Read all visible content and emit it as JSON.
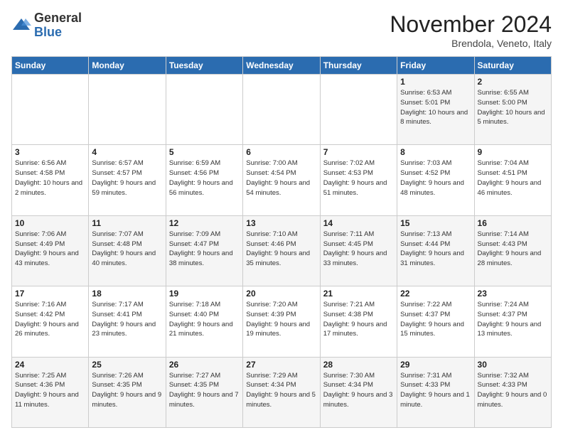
{
  "logo": {
    "general": "General",
    "blue": "Blue"
  },
  "title": "November 2024",
  "location": "Brendola, Veneto, Italy",
  "days_of_week": [
    "Sunday",
    "Monday",
    "Tuesday",
    "Wednesday",
    "Thursday",
    "Friday",
    "Saturday"
  ],
  "weeks": [
    [
      {
        "day": "",
        "info": ""
      },
      {
        "day": "",
        "info": ""
      },
      {
        "day": "",
        "info": ""
      },
      {
        "day": "",
        "info": ""
      },
      {
        "day": "",
        "info": ""
      },
      {
        "day": "1",
        "info": "Sunrise: 6:53 AM\nSunset: 5:01 PM\nDaylight: 10 hours and 8 minutes."
      },
      {
        "day": "2",
        "info": "Sunrise: 6:55 AM\nSunset: 5:00 PM\nDaylight: 10 hours and 5 minutes."
      }
    ],
    [
      {
        "day": "3",
        "info": "Sunrise: 6:56 AM\nSunset: 4:58 PM\nDaylight: 10 hours and 2 minutes."
      },
      {
        "day": "4",
        "info": "Sunrise: 6:57 AM\nSunset: 4:57 PM\nDaylight: 9 hours and 59 minutes."
      },
      {
        "day": "5",
        "info": "Sunrise: 6:59 AM\nSunset: 4:56 PM\nDaylight: 9 hours and 56 minutes."
      },
      {
        "day": "6",
        "info": "Sunrise: 7:00 AM\nSunset: 4:54 PM\nDaylight: 9 hours and 54 minutes."
      },
      {
        "day": "7",
        "info": "Sunrise: 7:02 AM\nSunset: 4:53 PM\nDaylight: 9 hours and 51 minutes."
      },
      {
        "day": "8",
        "info": "Sunrise: 7:03 AM\nSunset: 4:52 PM\nDaylight: 9 hours and 48 minutes."
      },
      {
        "day": "9",
        "info": "Sunrise: 7:04 AM\nSunset: 4:51 PM\nDaylight: 9 hours and 46 minutes."
      }
    ],
    [
      {
        "day": "10",
        "info": "Sunrise: 7:06 AM\nSunset: 4:49 PM\nDaylight: 9 hours and 43 minutes."
      },
      {
        "day": "11",
        "info": "Sunrise: 7:07 AM\nSunset: 4:48 PM\nDaylight: 9 hours and 40 minutes."
      },
      {
        "day": "12",
        "info": "Sunrise: 7:09 AM\nSunset: 4:47 PM\nDaylight: 9 hours and 38 minutes."
      },
      {
        "day": "13",
        "info": "Sunrise: 7:10 AM\nSunset: 4:46 PM\nDaylight: 9 hours and 35 minutes."
      },
      {
        "day": "14",
        "info": "Sunrise: 7:11 AM\nSunset: 4:45 PM\nDaylight: 9 hours and 33 minutes."
      },
      {
        "day": "15",
        "info": "Sunrise: 7:13 AM\nSunset: 4:44 PM\nDaylight: 9 hours and 31 minutes."
      },
      {
        "day": "16",
        "info": "Sunrise: 7:14 AM\nSunset: 4:43 PM\nDaylight: 9 hours and 28 minutes."
      }
    ],
    [
      {
        "day": "17",
        "info": "Sunrise: 7:16 AM\nSunset: 4:42 PM\nDaylight: 9 hours and 26 minutes."
      },
      {
        "day": "18",
        "info": "Sunrise: 7:17 AM\nSunset: 4:41 PM\nDaylight: 9 hours and 23 minutes."
      },
      {
        "day": "19",
        "info": "Sunrise: 7:18 AM\nSunset: 4:40 PM\nDaylight: 9 hours and 21 minutes."
      },
      {
        "day": "20",
        "info": "Sunrise: 7:20 AM\nSunset: 4:39 PM\nDaylight: 9 hours and 19 minutes."
      },
      {
        "day": "21",
        "info": "Sunrise: 7:21 AM\nSunset: 4:38 PM\nDaylight: 9 hours and 17 minutes."
      },
      {
        "day": "22",
        "info": "Sunrise: 7:22 AM\nSunset: 4:37 PM\nDaylight: 9 hours and 15 minutes."
      },
      {
        "day": "23",
        "info": "Sunrise: 7:24 AM\nSunset: 4:37 PM\nDaylight: 9 hours and 13 minutes."
      }
    ],
    [
      {
        "day": "24",
        "info": "Sunrise: 7:25 AM\nSunset: 4:36 PM\nDaylight: 9 hours and 11 minutes."
      },
      {
        "day": "25",
        "info": "Sunrise: 7:26 AM\nSunset: 4:35 PM\nDaylight: 9 hours and 9 minutes."
      },
      {
        "day": "26",
        "info": "Sunrise: 7:27 AM\nSunset: 4:35 PM\nDaylight: 9 hours and 7 minutes."
      },
      {
        "day": "27",
        "info": "Sunrise: 7:29 AM\nSunset: 4:34 PM\nDaylight: 9 hours and 5 minutes."
      },
      {
        "day": "28",
        "info": "Sunrise: 7:30 AM\nSunset: 4:34 PM\nDaylight: 9 hours and 3 minutes."
      },
      {
        "day": "29",
        "info": "Sunrise: 7:31 AM\nSunset: 4:33 PM\nDaylight: 9 hours and 1 minute."
      },
      {
        "day": "30",
        "info": "Sunrise: 7:32 AM\nSunset: 4:33 PM\nDaylight: 9 hours and 0 minutes."
      }
    ]
  ]
}
